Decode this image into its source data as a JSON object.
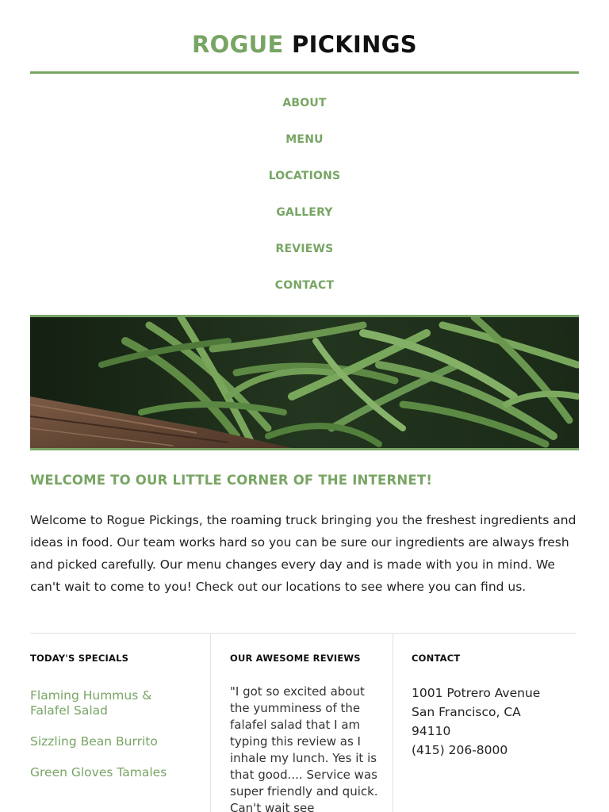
{
  "brand": {
    "name_part1": "ROGUE",
    "name_part2": "PICKINGS",
    "accent_color": "#78a564"
  },
  "nav": {
    "items": [
      {
        "label": "ABOUT"
      },
      {
        "label": "MENU"
      },
      {
        "label": "LOCATIONS"
      },
      {
        "label": "GALLERY"
      },
      {
        "label": "REVIEWS"
      },
      {
        "label": "CONTACT"
      }
    ]
  },
  "hero": {
    "image_subject": "green beans on a wooden crate"
  },
  "welcome": {
    "title": "WELCOME TO OUR LITTLE CORNER OF THE INTERNET!",
    "body": "Welcome to Rogue Pickings, the roaming truck bringing you the freshest ingredients and ideas in food. Our team works hard so you can be sure our ingredients are always fresh and picked carefully. Our menu changes every day and is made with you in mind. We can't wait to come to you! Check out our locations to see where you can find us."
  },
  "specials": {
    "heading": "TODAY'S SPECIALS",
    "items": [
      {
        "label": "Flaming Hummus & Falafel Salad"
      },
      {
        "label": "Sizzling Bean Burrito"
      },
      {
        "label": "Green Gloves Tamales"
      }
    ]
  },
  "reviews": {
    "heading": "OUR AWESOME REVIEWS",
    "text": "\"I got so excited about the yumminess of the falafel salad that I am typing this review as I inhale my lunch. Yes it is that good.... Service was super friendly and quick. Can't wait see"
  },
  "contact": {
    "heading": "CONTACT",
    "street": "1001 Potrero Avenue",
    "city": "San Francisco, CA",
    "zip": "94110",
    "phone": "(415) 206-8000"
  }
}
